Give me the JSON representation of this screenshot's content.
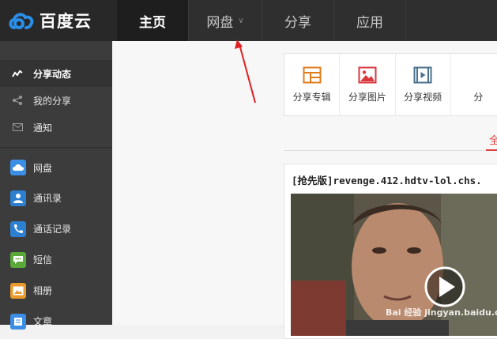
{
  "brand": {
    "name": "百度云",
    "logo_color": "#2a8ee8"
  },
  "nav": {
    "items": [
      {
        "label": "主页",
        "active": true
      },
      {
        "label": "网盘",
        "has_dropdown": true
      },
      {
        "label": "分享"
      },
      {
        "label": "应用"
      }
    ]
  },
  "sidebar": {
    "items": [
      {
        "label": "分享动态",
        "icon": "activity-icon",
        "active": true
      },
      {
        "label": "我的分享",
        "icon": "share-icon"
      },
      {
        "label": "通知",
        "icon": "mail-icon"
      },
      {
        "label": "网盘",
        "icon": "cloud-icon",
        "color": "#3a8ee6"
      },
      {
        "label": "通讯录",
        "icon": "contacts-icon",
        "color": "#2d7fd0"
      },
      {
        "label": "通话记录",
        "icon": "call-log-icon",
        "color": "#2d7fd0"
      },
      {
        "label": "短信",
        "icon": "sms-icon",
        "color": "#5aa83a"
      },
      {
        "label": "相册",
        "icon": "album-icon",
        "color": "#e89a2a"
      },
      {
        "label": "文章",
        "icon": "article-icon",
        "color": "#3a8ee6"
      }
    ]
  },
  "shortcuts": [
    {
      "label": "分享专辑",
      "icon": "album-share-icon",
      "color": "#e07b1a"
    },
    {
      "label": "分享图片",
      "icon": "image-icon",
      "color": "#d9363e"
    },
    {
      "label": "分享视频",
      "icon": "video-icon",
      "color": "#4a6f8c"
    },
    {
      "label": "分",
      "icon": "more-icon"
    }
  ],
  "feed": {
    "tab_all": "全",
    "post_title": "[抢先版]revenge.412.hdtv-lol.chs."
  },
  "watermark": "Bai 经验 jingyan.baidu.com"
}
